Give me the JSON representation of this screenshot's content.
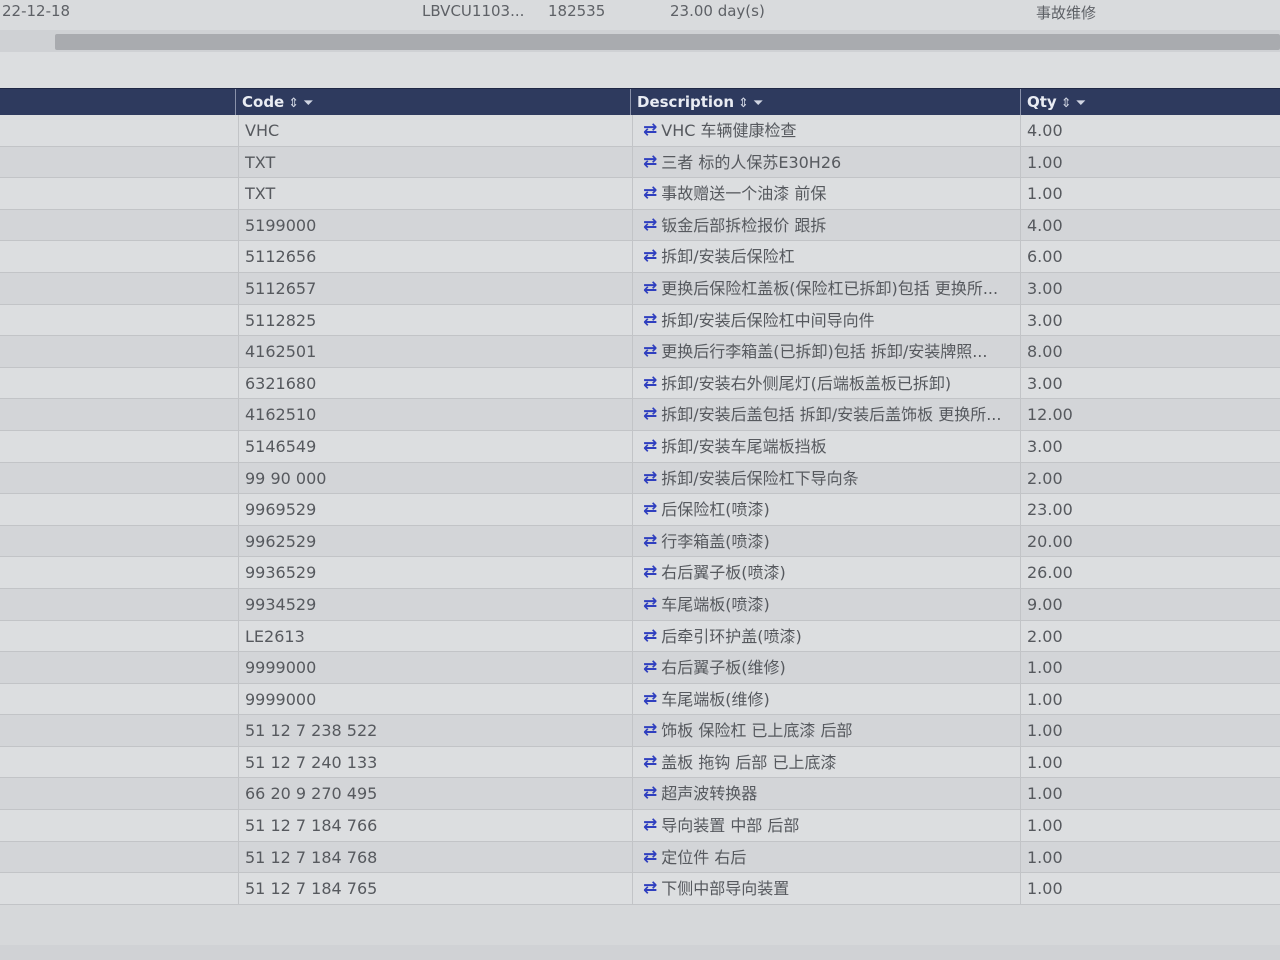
{
  "summary": {
    "date": "22-12-18",
    "vin": "LBVCU1103...",
    "mileage": "182535",
    "duration": "23.00 day(s)",
    "type": "事故维修"
  },
  "table": {
    "columns": [
      {
        "key": "code",
        "label": "Code",
        "sort_icon": "⇕",
        "filter_icon": "⏷"
      },
      {
        "key": "description",
        "label": "Description",
        "sort_icon": "⇕",
        "filter_icon": "⏷"
      },
      {
        "key": "qty",
        "label": "Qty",
        "sort_icon": "⇕",
        "filter_icon": "⏷"
      }
    ],
    "row_icon": "swap-icon",
    "rows": [
      {
        "code": "VHC",
        "description": "VHC 车辆健康检查",
        "qty": "4.00"
      },
      {
        "code": "TXT",
        "description": "三者 标的人保苏E30H26",
        "qty": "1.00"
      },
      {
        "code": "TXT",
        "description": "事故赠送一个油漆 前保",
        "qty": "1.00"
      },
      {
        "code": "5199000",
        "description": "钣金后部拆检报价 跟拆",
        "qty": "4.00"
      },
      {
        "code": "5112656",
        "description": "拆卸/安装后保险杠",
        "qty": "6.00"
      },
      {
        "code": "5112657",
        "description": "更换后保险杠盖板(保险杠已拆卸)包括 更换所...",
        "qty": "3.00"
      },
      {
        "code": "5112825",
        "description": "拆卸/安装后保险杠中间导向件",
        "qty": "3.00"
      },
      {
        "code": "4162501",
        "description": "更换后行李箱盖(已拆卸)包括 拆卸/安装牌照...",
        "qty": "8.00"
      },
      {
        "code": "6321680",
        "description": "拆卸/安装右外侧尾灯(后端板盖板已拆卸)",
        "qty": "3.00"
      },
      {
        "code": "4162510",
        "description": "拆卸/安装后盖包括 拆卸/安装后盖饰板 更换所...",
        "qty": "12.00"
      },
      {
        "code": "5146549",
        "description": "拆卸/安装车尾端板挡板",
        "qty": "3.00"
      },
      {
        "code": "99 90 000",
        "description": "拆卸/安装后保险杠下导向条",
        "qty": "2.00"
      },
      {
        "code": "9969529",
        "description": "后保险杠(喷漆)",
        "qty": "23.00"
      },
      {
        "code": "9962529",
        "description": "行李箱盖(喷漆)",
        "qty": "20.00"
      },
      {
        "code": "9936529",
        "description": "右后翼子板(喷漆)",
        "qty": "26.00"
      },
      {
        "code": "9934529",
        "description": "车尾端板(喷漆)",
        "qty": "9.00"
      },
      {
        "code": "LE2613",
        "description": "后牵引环护盖(喷漆)",
        "qty": "2.00"
      },
      {
        "code": "9999000",
        "description": "右后翼子板(维修)",
        "qty": "1.00"
      },
      {
        "code": "9999000",
        "description": "车尾端板(维修)",
        "qty": "1.00"
      },
      {
        "code": "51 12 7 238 522",
        "description": "饰板 保险杠 已上底漆 后部",
        "qty": "1.00"
      },
      {
        "code": "51 12 7 240 133",
        "description": "盖板 拖钩 后部 已上底漆",
        "qty": "1.00"
      },
      {
        "code": "66 20 9 270 495",
        "description": "超声波转换器",
        "qty": "1.00"
      },
      {
        "code": "51 12 7 184 766",
        "description": "导向装置 中部 后部",
        "qty": "1.00"
      },
      {
        "code": "51 12 7 184 768",
        "description": "定位件 右后",
        "qty": "1.00"
      },
      {
        "code": "51 12 7 184 765",
        "description": "下侧中部导向装置",
        "qty": "1.00"
      }
    ]
  }
}
